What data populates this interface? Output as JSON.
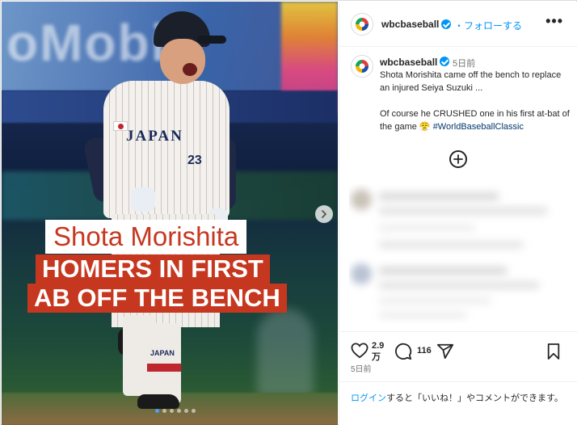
{
  "media": {
    "headline_line1": "Shota Morishita",
    "headline_line2": "HOMERS IN FIRST",
    "headline_line3": "AB OFF THE BENCH",
    "jersey_text": "JAPAN",
    "jersey_number": "23",
    "sock_text": "JAPAN",
    "carousel_dots": 6,
    "carousel_active_index": 0
  },
  "post": {
    "username": "wbcbaseball",
    "follow_label": "・フォローする",
    "more_label": "•••",
    "caption_time": "5日前",
    "caption_line1": "Shota Morishita came off the bench to replace an injured Seiya Suzuki ...",
    "caption_line2_text": "Of course he CRUSHED one in his first at-bat of the game 😤 ",
    "hashtag": "#WorldBaseballClassic",
    "like_count_top": "2.9",
    "like_count_bottom": "万",
    "comment_count": "116",
    "post_time": "5日前"
  },
  "footer": {
    "login_link": "ログイン",
    "login_rest": "すると「いいね！」やコメントができます。"
  },
  "colors": {
    "accent_blue": "#0095f6",
    "headline_red": "#c6371f",
    "hashtag_blue": "#00376b"
  },
  "icons": {
    "heart": "heart-icon",
    "comment": "comment-icon",
    "share": "share-icon",
    "bookmark": "bookmark-icon",
    "next": "chevron-right-icon",
    "add": "plus-circle-icon"
  }
}
